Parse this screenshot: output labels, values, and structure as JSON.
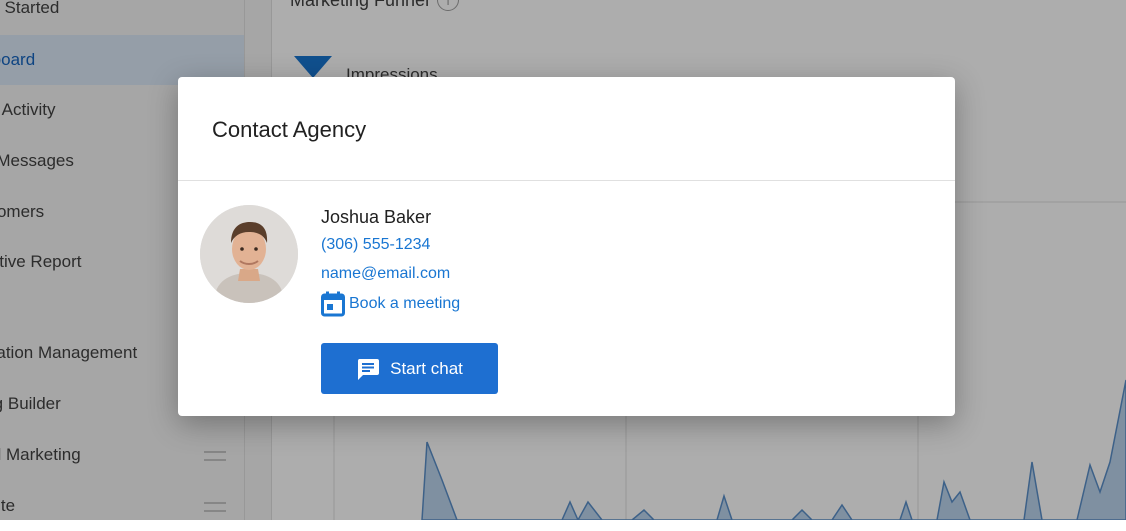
{
  "sidebar": {
    "items": [
      {
        "label": "Getting Started"
      },
      {
        "label": "Dashboard"
      },
      {
        "label": "Recent Activity"
      },
      {
        "label": "My Messages"
      },
      {
        "label": "Customers"
      },
      {
        "label": "Executive Report"
      },
      {
        "label": "Reputation Management"
      },
      {
        "label": "Listing Builder"
      },
      {
        "label": "Social Marketing"
      },
      {
        "label": "Website"
      }
    ]
  },
  "main": {
    "card_title": "Marketing Funnel",
    "funnel_label": "Impressions"
  },
  "modal": {
    "title": "Contact Agency",
    "contact": {
      "name": "Joshua Baker",
      "phone": "(306) 555-1234",
      "email": "name@email.com",
      "book_label": "Book a meeting"
    },
    "chat_button_label": "Start chat"
  },
  "colors": {
    "primary": "#1976d2",
    "button": "#1e6fd1",
    "sidebar_active_bg": "#dce9f8",
    "chart_fill": "#bcd4ee",
    "chart_stroke": "#5b8fc9"
  },
  "icons": {
    "info": "info-icon",
    "funnel": "funnel-icon",
    "calendar": "calendar-icon",
    "chat": "chat-icon",
    "drag": "drag-handle-icon"
  }
}
